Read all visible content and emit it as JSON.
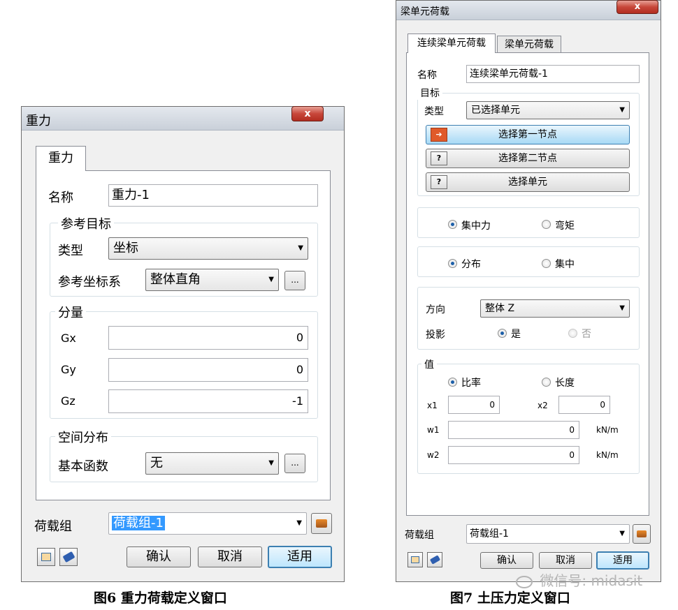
{
  "gravity": {
    "window_title": "重力",
    "close_glyph": "x",
    "tab_label": "重力",
    "name_label": "名称",
    "name_value": "重力-1",
    "ref_target": {
      "legend": "参考目标",
      "type_label": "类型",
      "type_value": "坐标",
      "coord_label": "参考坐标系",
      "coord_value": "整体直角",
      "ellipsis": "..."
    },
    "components": {
      "legend": "分量",
      "rows": [
        {
          "label": "Gx",
          "value": "0"
        },
        {
          "label": "Gy",
          "value": "0"
        },
        {
          "label": "Gz",
          "value": "-1"
        }
      ]
    },
    "spatial": {
      "legend": "空间分布",
      "func_label": "基本函数",
      "func_value": "无",
      "ellipsis": "..."
    },
    "load_group_label": "荷载组",
    "load_group_value": "荷载组-1",
    "buttons": {
      "ok": "确认",
      "cancel": "取消",
      "apply": "适用"
    }
  },
  "beam": {
    "window_title": "梁单元荷载",
    "close_glyph": "x",
    "tabs": [
      "连续梁单元荷载",
      "梁单元荷载"
    ],
    "name_label": "名称",
    "name_value": "连续梁单元荷载-1",
    "target": {
      "legend": "目标",
      "type_label": "类型",
      "type_value": "已选择单元",
      "btn_first_node": "选择第一节点",
      "btn_second_node": "选择第二节点",
      "btn_select_element": "选择单元",
      "q_mark": "?"
    },
    "load_kind": {
      "option1": "集中力",
      "option2": "弯矩"
    },
    "distribution": {
      "option1": "分布",
      "option2": "集中"
    },
    "direction": {
      "label": "方向",
      "value": "整体 Z",
      "projection_label": "投影",
      "yes": "是",
      "no": "否"
    },
    "value": {
      "legend": "值",
      "ratio": "比率",
      "length": "长度",
      "x1_label": "x1",
      "x1_value": "0",
      "x2_label": "x2",
      "x2_value": "0",
      "w1_label": "w1",
      "w1_value": "0",
      "w1_unit": "kN/m",
      "w2_label": "w2",
      "w2_value": "0",
      "w2_unit": "kN/m"
    },
    "load_group_label": "荷载组",
    "load_group_value": "荷载组-1",
    "buttons": {
      "ok": "确认",
      "cancel": "取消",
      "apply": "适用"
    }
  },
  "captions": {
    "fig6": "图6  重力荷载定义窗口",
    "fig7": "图7  土压力定义窗口"
  },
  "watermark": "微信号: midasit",
  "colors": {
    "selection_highlight": "#3399ff",
    "close_button": "#c7473a",
    "focus_border": "#3c7fb1"
  }
}
